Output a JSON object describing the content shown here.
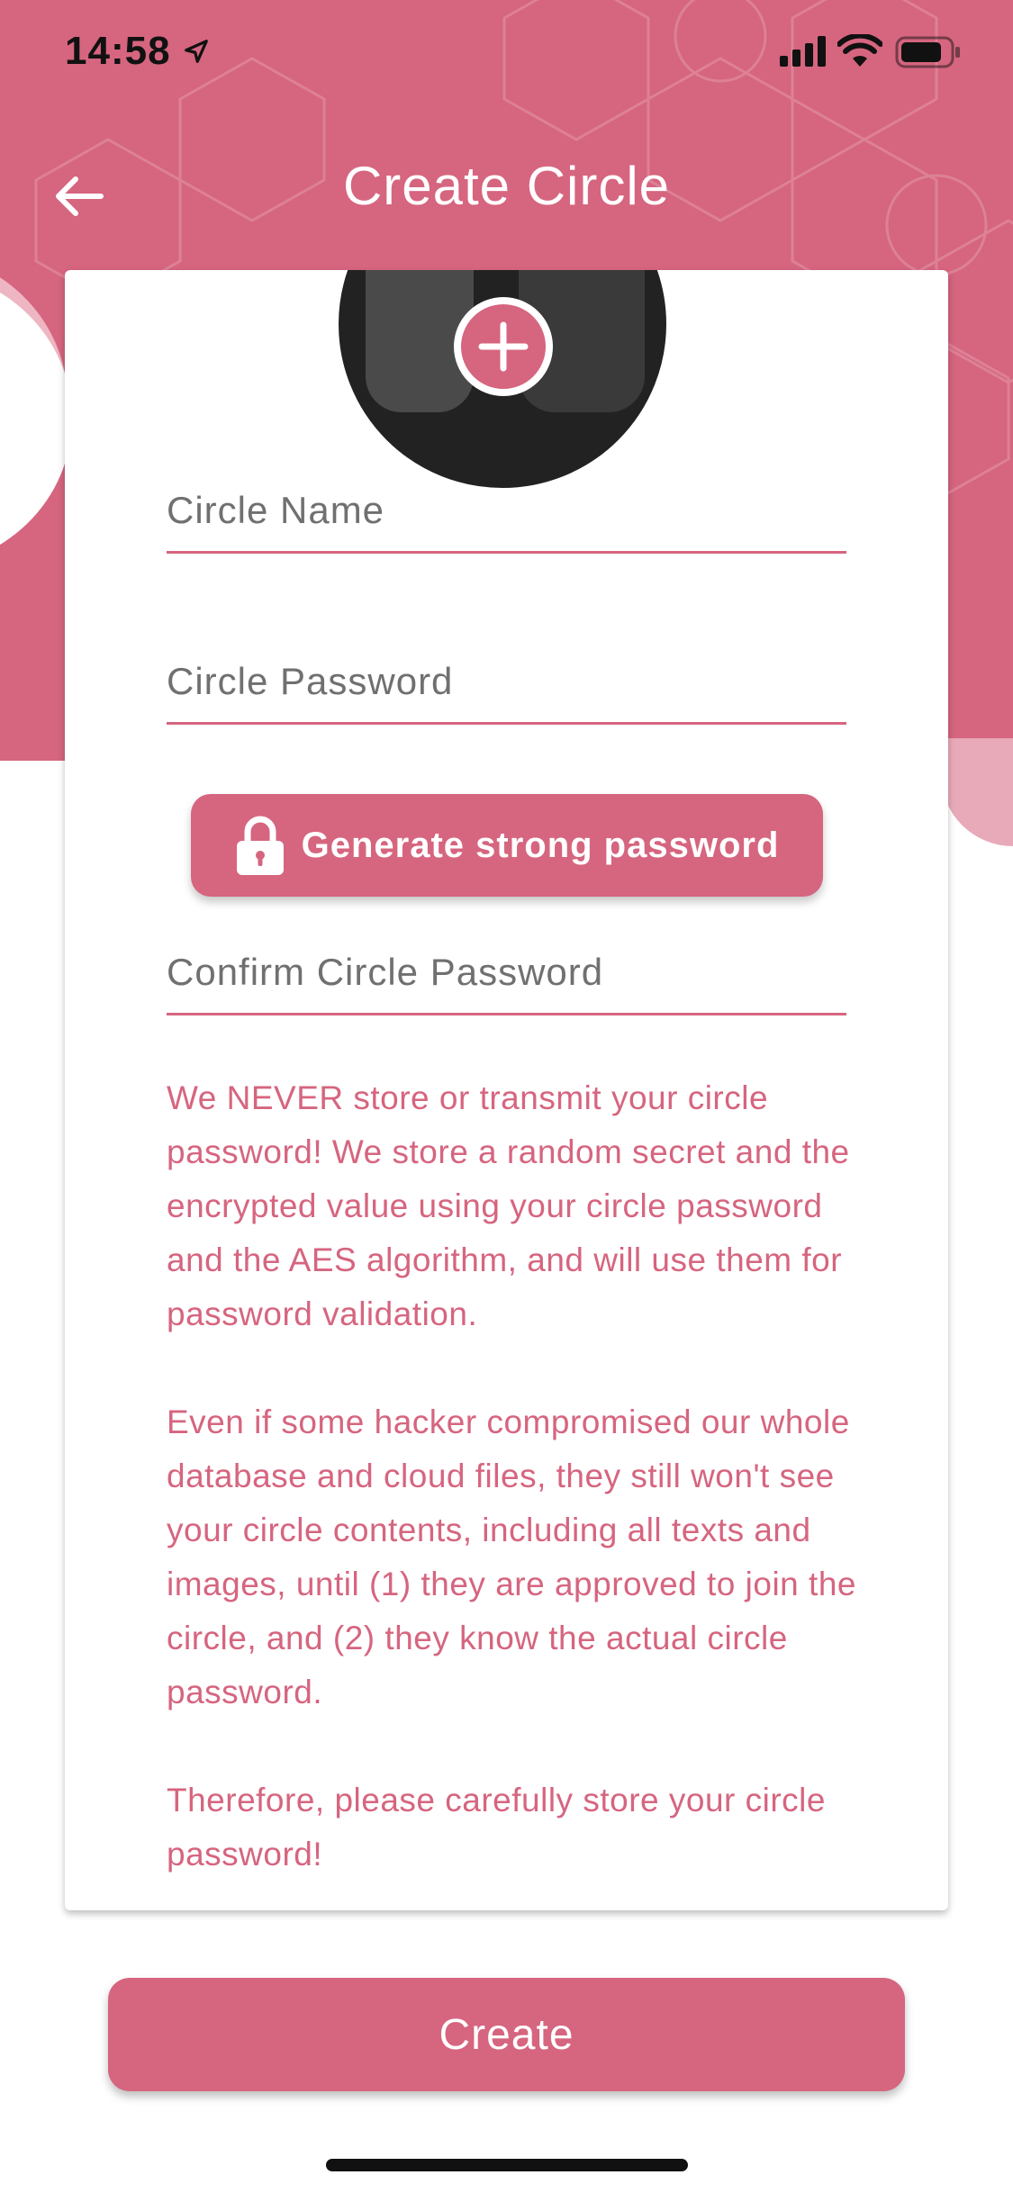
{
  "status_bar": {
    "time": "14:58",
    "icons": [
      "location-arrow-icon",
      "signal-icon",
      "wifi-icon",
      "battery-icon"
    ]
  },
  "nav": {
    "title": "Create Circle",
    "back_icon": "arrow-left-icon"
  },
  "form": {
    "circle_name_placeholder": "Circle Name",
    "circle_password_placeholder": "Circle Password",
    "generate_button_label": "Generate strong password",
    "confirm_password_placeholder": "Confirm Circle Password"
  },
  "notice": {
    "paragraph1": "We NEVER store or transmit your circle password! We store a random secret and the encrypted value using your circle password and the AES algorithm, and will use them for password validation.",
    "paragraph2": "Even if some hacker compromised our whole database and cloud files, they still won't see your circle contents, including all texts and images, until (1) they are approved to join the circle, and (2) they know the actual circle password.",
    "paragraph3": "Therefore, please carefully store your circle password!"
  },
  "actions": {
    "create_label": "Create"
  },
  "colors": {
    "accent": "#d6657f",
    "card": "#ffffff",
    "placeholder": "#707070"
  }
}
